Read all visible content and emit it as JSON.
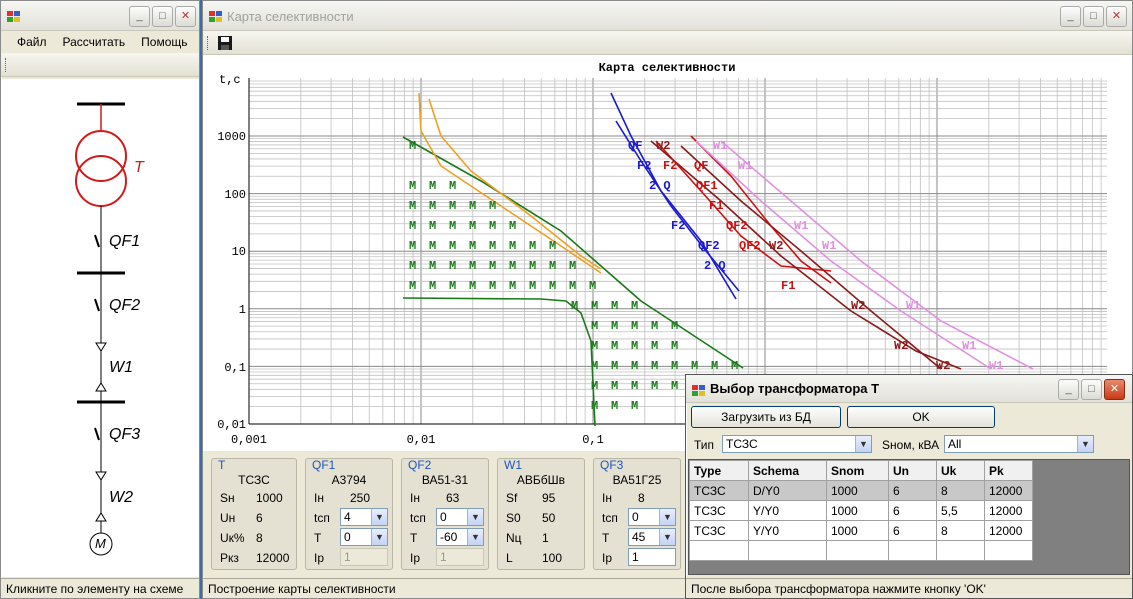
{
  "main_window": {
    "menu": [
      "Файл",
      "Рассчитать",
      "Помощь"
    ],
    "status": "Кликните по элементу на схеме",
    "scheme": {
      "transformer_label": "T",
      "breaker1_label": "QF1",
      "breaker2_label": "QF2",
      "line1_label": "W1",
      "breaker3_label": "QF3",
      "line2_label": "W2",
      "motor_label": "M"
    }
  },
  "map_window": {
    "title": "Карта селективности",
    "status": "Построение карты селективности",
    "chart_title": "Карта селективности",
    "y_axis_label": "t,c",
    "y_ticks": [
      "1000",
      "100",
      "10",
      "1",
      "0,1",
      "0,01"
    ],
    "x_ticks": [
      "0,001",
      "0,01",
      "0,1"
    ],
    "panels": {
      "t": {
        "title": "T",
        "name": "ТСЗС",
        "rows": [
          {
            "label": "Sн",
            "value": "1000"
          },
          {
            "label": "Uн",
            "value": "6"
          },
          {
            "label": "Uк%",
            "value": "8"
          },
          {
            "label": "Pкз",
            "value": "12000"
          }
        ]
      },
      "qf1": {
        "title": "QF1",
        "name": "А3794",
        "in_label": "Iн",
        "in_value": "250",
        "tsp_label": "tсп",
        "tsp_value": "4",
        "t_label": "T",
        "t_value": "0",
        "ip_label": "Iр",
        "ip_value": "1"
      },
      "qf2": {
        "title": "QF2",
        "name": "ВА51-31",
        "in_label": "Iн",
        "in_value": "63",
        "tsp_label": "tсп",
        "tsp_value": "0",
        "t_label": "T",
        "t_value": "-60",
        "ip_label": "Iр",
        "ip_value": "1"
      },
      "w1": {
        "title": "W1",
        "name": "АВБбШв",
        "rows": [
          {
            "label": "Sf",
            "value": "95"
          },
          {
            "label": "S0",
            "value": "50"
          },
          {
            "label": "Nц",
            "value": "1"
          },
          {
            "label": "L",
            "value": "100"
          }
        ]
      },
      "qf3": {
        "title": "QF3",
        "name": "ВА51Г25",
        "in_label": "Iн",
        "in_value": "8",
        "tsp_label": "tсп",
        "tsp_value": "0",
        "t_label": "T",
        "t_value": "45",
        "ip_label": "Iр",
        "ip_value": "1"
      }
    }
  },
  "dialog": {
    "title": "Выбор трансформатора T",
    "load_button": "Загрузить из БД",
    "ok_button": "OK",
    "type_label": "Тип",
    "type_value": "ТСЗС",
    "snom_label": "Sном, кВА",
    "snom_value": "All",
    "status": "После выбора трансформатора нажмите кнопку 'OK'",
    "columns": [
      "Type",
      "Schema",
      "Snom",
      "Un",
      "Uk",
      "Pk"
    ],
    "rows": [
      [
        "ТСЗС",
        "D/Y0",
        "1000",
        "6",
        "8",
        "12000"
      ],
      [
        "ТСЗС",
        "Y/Y0",
        "1000",
        "6",
        "5,5",
        "12000"
      ],
      [
        "ТСЗС",
        "Y/Y0",
        "1000",
        "6",
        "8",
        "12000"
      ]
    ]
  },
  "colors": {
    "scheme_red": "#d21a1a",
    "curve_green": "#1a7a1a",
    "curve_orange": "#f0a020",
    "curve_blue": "#1a1ad0",
    "curve_red": "#d01010",
    "curve_darkred": "#8b1a1a",
    "curve_violet": "#e090e0"
  }
}
